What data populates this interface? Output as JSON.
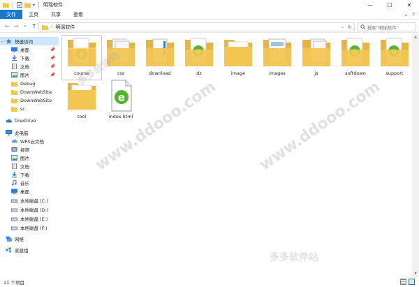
{
  "window": {
    "title": "明瑶软件",
    "minimize": "—",
    "maximize": "☐",
    "close": "✕"
  },
  "ribbon": {
    "tabs": [
      "文件",
      "主页",
      "共享",
      "查看"
    ],
    "collapse": "⌄",
    "help": "?"
  },
  "address": {
    "path": "明瑶软件",
    "search_placeholder": "搜索\"明瑶软件\""
  },
  "nav": {
    "quick_access": "快速访问",
    "pinned": [
      {
        "label": "桌面",
        "icon": "desktop-icon"
      },
      {
        "label": "下载",
        "icon": "download-arrow-icon"
      },
      {
        "label": "文档",
        "icon": "document-icon"
      },
      {
        "label": "图片",
        "icon": "picture-icon"
      }
    ],
    "recent": [
      "Debug",
      "DownWebSite",
      "DownWebSite",
      "sc"
    ],
    "onedrive": "OneDrive",
    "this_pc": "此电脑",
    "pc_items": [
      {
        "label": "WPS云文档",
        "icon": "cloud-icon"
      },
      {
        "label": "视频",
        "icon": "video-icon"
      },
      {
        "label": "图片",
        "icon": "picture-icon"
      },
      {
        "label": "文档",
        "icon": "document-icon"
      },
      {
        "label": "下载",
        "icon": "download-arrow-icon"
      },
      {
        "label": "音乐",
        "icon": "music-icon"
      },
      {
        "label": "桌面",
        "icon": "desktop-icon"
      },
      {
        "label": "本地磁盘 (C:)",
        "icon": "drive-icon"
      },
      {
        "label": "本地磁盘 (D:)",
        "icon": "drive-icon"
      },
      {
        "label": "本地磁盘 (E:)",
        "icon": "drive-icon"
      },
      {
        "label": "本地磁盘 (F:)",
        "icon": "drive-icon"
      }
    ],
    "network": "网络",
    "homegroup": "家庭组"
  },
  "files": [
    {
      "name": "course",
      "type": "folder-ie"
    },
    {
      "name": "css",
      "type": "folder-docs"
    },
    {
      "name": "download",
      "type": "folder-blue"
    },
    {
      "name": "dz",
      "type": "folder-ie"
    },
    {
      "name": "image",
      "type": "folder"
    },
    {
      "name": "images",
      "type": "folder-img"
    },
    {
      "name": "js",
      "type": "folder-docs"
    },
    {
      "name": "softdown",
      "type": "folder-ie"
    },
    {
      "name": "support",
      "type": "folder-ie"
    },
    {
      "name": "tool",
      "type": "folder"
    },
    {
      "name": "index.html",
      "type": "ie-file"
    }
  ],
  "status": {
    "count": "11 个项目"
  },
  "watermark": "www.ddooo.com",
  "watermark2": "多多软件站",
  "colors": {
    "accent": "#1979ca",
    "folder": "#f3c652",
    "ie_green": "#52b52d",
    "selection": "#cce8ff"
  }
}
